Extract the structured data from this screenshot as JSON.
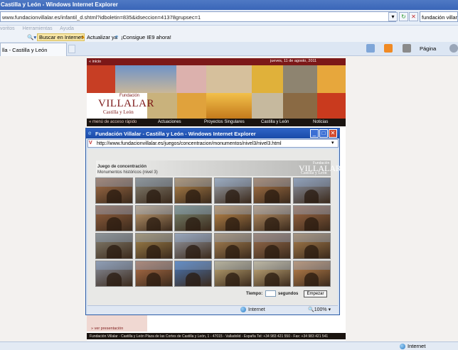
{
  "window": {
    "title": "Castilla y León - Windows Internet Explorer"
  },
  "address": {
    "url": "www.fundacionvillalar.es/infantil_d.shtml?idboletin=835&idseccion=41378grupsec=1",
    "search_value": "fundación villar"
  },
  "menubar": {
    "items": [
      "voritos",
      "Herramientas",
      "Ayuda"
    ]
  },
  "linksbar": {
    "search_button": "Buscar en Internet",
    "update_link": "Actualizar ya",
    "ie9_link": "¡Consigue IE9 ahora!"
  },
  "tab": {
    "label": "lla - Castilla y León"
  },
  "toolbar": {
    "page_label": "Página"
  },
  "site": {
    "inicio": "« inicio",
    "date": "jueves, 11 de agosto, 2011",
    "logo_small": "Fundación",
    "logo_big": "VILLALAR",
    "logo_sub": "Castilla y León",
    "nav": [
      "« menú de acceso rápido",
      "Actuaciones",
      "Proyectos Singulares",
      "Castilla y León",
      "Noticias"
    ],
    "ver_presentacion": "» ver presentación",
    "footer": "Fundación Villalar - Castilla y León     Plaza de las Cortes de Castilla y León, 1 - 47015 - Valladolid - España     Tel: +34 983 421 550 - Fax: +34 983 421 541"
  },
  "popup": {
    "title": "Fundación Villalar - Castilla y León - Windows Internet Explorer",
    "url": "http://www.fundacionvillalar.es/juegos/concentracion/monumentos/nivel3/nivel3.html",
    "status_zone": "Internet",
    "zoom": "100%"
  },
  "game": {
    "title": "Juego de concentración",
    "subtitle": "Monumentos históricos (nivel 3)",
    "logo_small": "Fundación",
    "logo_big": "VILLALAR",
    "logo_sub": "Castilla y León",
    "timer_label": "Tiempo:",
    "timer_value": "",
    "timer_unit": "segundos",
    "start_button": "Empezar",
    "cards": [
      {
        "icon": "arch-portal",
        "color": "#a8724a"
      },
      {
        "icon": "cloister",
        "color": "#8a8678"
      },
      {
        "icon": "gothic-facade",
        "color": "#b98a4e"
      },
      {
        "icon": "city-wall",
        "color": "#9fa6b0"
      },
      {
        "icon": "cathedral",
        "color": "#b07a4a"
      },
      {
        "icon": "aqueduct",
        "color": "#8e96a6"
      },
      {
        "icon": "arch-portal",
        "color": "#9a6440"
      },
      {
        "icon": "city-wall",
        "color": "#c9a477"
      },
      {
        "icon": "cloister",
        "color": "#7c8a74"
      },
      {
        "icon": "dome",
        "color": "#c8904e"
      },
      {
        "icon": "city-wall",
        "color": "#c49a6c"
      },
      {
        "icon": "arch-portal",
        "color": "#a46c46"
      },
      {
        "icon": "window-arch",
        "color": "#8a8474"
      },
      {
        "icon": "gothic-facade",
        "color": "#a9894e"
      },
      {
        "icon": "city-wall",
        "color": "#9a9ea8"
      },
      {
        "icon": "cathedral",
        "color": "#b28a58"
      },
      {
        "icon": "window-arch",
        "color": "#a07250"
      },
      {
        "icon": "gothic-facade",
        "color": "#b08450"
      },
      {
        "icon": "aqueduct",
        "color": "#8c92a0"
      },
      {
        "icon": "dome",
        "color": "#b8744a"
      },
      {
        "icon": "cathedral",
        "color": "#4a78b8"
      },
      {
        "icon": "castle",
        "color": "#c8b07a"
      },
      {
        "icon": "castle",
        "color": "#d2b884"
      },
      {
        "icon": "dome",
        "color": "#c98a50"
      }
    ]
  },
  "status": {
    "zone": "Internet"
  }
}
